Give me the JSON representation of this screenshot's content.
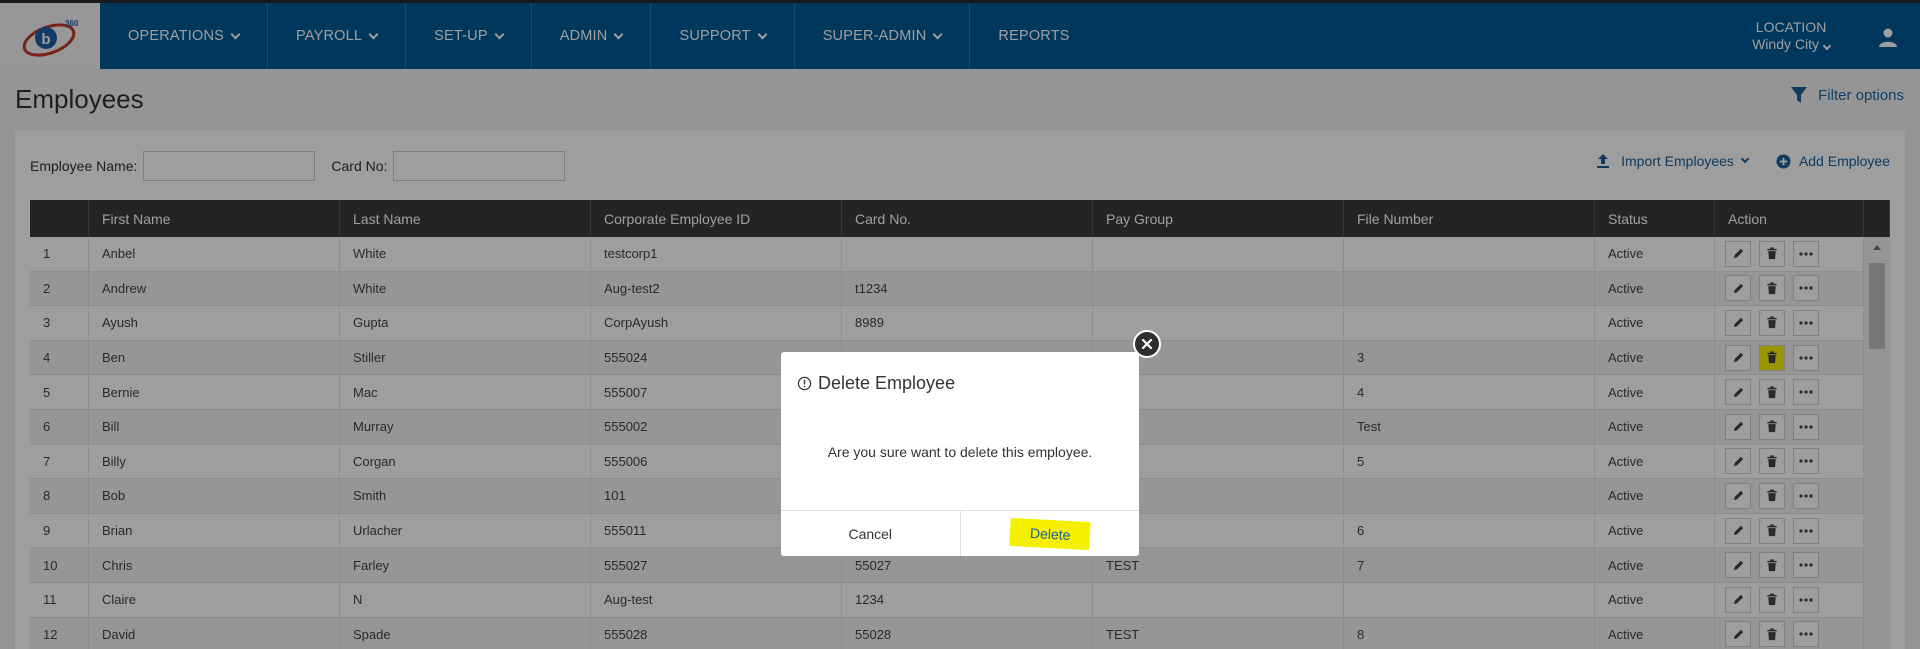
{
  "brand": {
    "logo_text": "360"
  },
  "nav": {
    "items": [
      {
        "label": "OPERATIONS",
        "dropdown": true
      },
      {
        "label": "PAYROLL",
        "dropdown": true
      },
      {
        "label": "SET-UP",
        "dropdown": true
      },
      {
        "label": "ADMIN",
        "dropdown": true
      },
      {
        "label": "SUPPORT",
        "dropdown": true
      },
      {
        "label": "SUPER-ADMIN",
        "dropdown": true
      },
      {
        "label": "REPORTS",
        "dropdown": false
      }
    ],
    "location_label": "LOCATION",
    "location_value": "Windy City"
  },
  "page": {
    "title": "Employees",
    "filter_label": "Filter options"
  },
  "search": {
    "employee_name_label": "Employee Name:",
    "employee_name_value": "",
    "card_no_label": "Card No:",
    "card_no_value": ""
  },
  "toolbar": {
    "import_label": "Import Employees",
    "add_label": "Add Employee"
  },
  "table": {
    "headers": [
      "",
      "First Name",
      "Last Name",
      "Corporate Employee ID",
      "Card No.",
      "Pay Group",
      "File Number",
      "Status",
      "Action"
    ],
    "rows": [
      [
        "1",
        "Anbel",
        "White",
        "testcorp1",
        "",
        "",
        "",
        "Active"
      ],
      [
        "2",
        "Andrew",
        "White",
        "Aug-test2",
        "t1234",
        "",
        "",
        "Active"
      ],
      [
        "3",
        "Ayush",
        "Gupta",
        "CorpAyush",
        "8989",
        "",
        "",
        "Active"
      ],
      [
        "4",
        "Ben",
        "Stiller",
        "555024",
        "",
        "",
        "3",
        "Active"
      ],
      [
        "5",
        "Bernie",
        "Mac",
        "555007",
        "",
        "",
        "4",
        "Active"
      ],
      [
        "6",
        "Bill",
        "Murray",
        "555002",
        "",
        "",
        "Test",
        "Active"
      ],
      [
        "7",
        "Billy",
        "Corgan",
        "555006",
        "",
        "",
        "5",
        "Active"
      ],
      [
        "8",
        "Bob",
        "Smith",
        "101",
        "",
        "",
        "",
        "Active"
      ],
      [
        "9",
        "Brian",
        "Urlacher",
        "555011",
        "",
        "",
        "6",
        "Active"
      ],
      [
        "10",
        "Chris",
        "Farley",
        "555027",
        "55027",
        "TEST",
        "7",
        "Active"
      ],
      [
        "11",
        "Claire",
        "N",
        "Aug-test",
        "1234",
        "",
        "",
        "Active"
      ],
      [
        "12",
        "David",
        "Spade",
        "555028",
        "55028",
        "TEST",
        "8",
        "Active"
      ]
    ]
  },
  "modal": {
    "title": "Delete Employee",
    "message": "Are you sure want to delete this employee.",
    "cancel_label": "Cancel",
    "delete_label": "Delete"
  },
  "colors": {
    "nav_bg": "#005b96",
    "accent": "#1a5f9a",
    "highlight": "#f5f000",
    "table_header": "#3a3a3a"
  }
}
